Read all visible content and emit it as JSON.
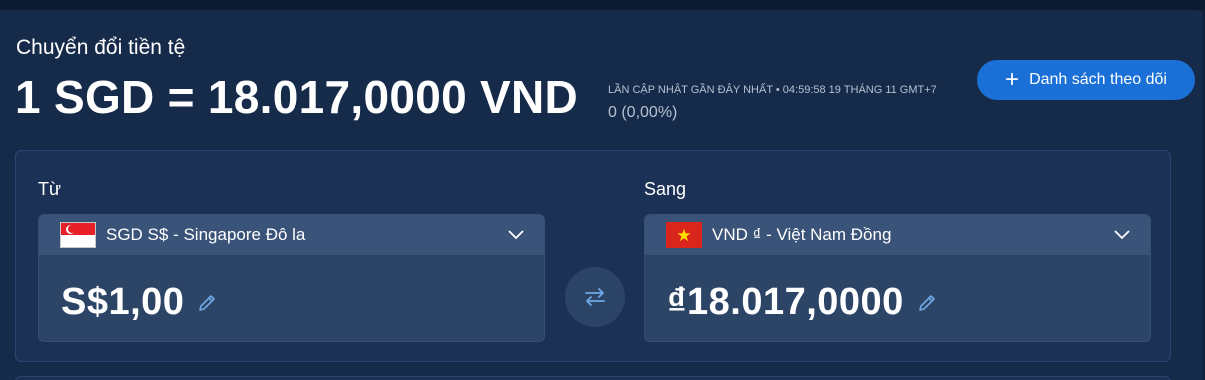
{
  "header": {
    "title": "Chuyển đổi tiền tệ",
    "rate_headline": "1 SGD = 18.017,0000 VND",
    "last_updated": "LẦN CẬP NHẬT GẦN ĐÂY NHẤT • 04:59:58 19 THÁNG 11 GMT+7",
    "change": "0 (0,00%)"
  },
  "watchlist_button": {
    "icon": "plus-icon",
    "label": "Danh sách theo dõi"
  },
  "converter": {
    "from": {
      "label": "Từ",
      "currency": "SGD S$ - Singapore Đô la",
      "flag_icon": "singapore-flag-icon",
      "amount": "S$1,00"
    },
    "to": {
      "label": "Sang",
      "currency": "VND ₫ - Việt Nam Đồng",
      "flag_icon": "vietnam-flag-icon",
      "amount": "₫18.017,0000"
    },
    "swap_icon": "swap-arrows-icon"
  },
  "colors": {
    "background": "#162a4a",
    "card": "#1b3155",
    "accent": "#1a70d6",
    "icon_blue": "#6ea8e6"
  }
}
